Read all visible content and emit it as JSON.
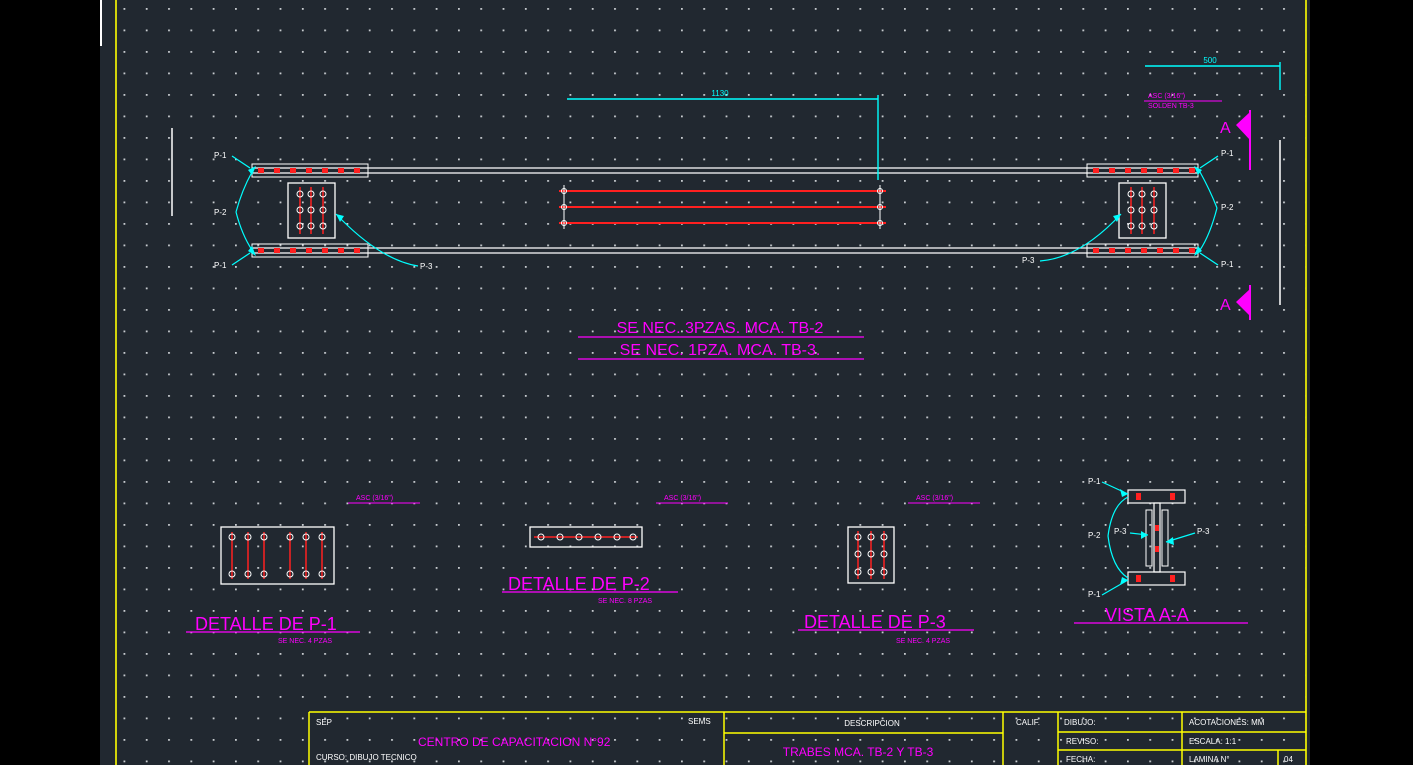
{
  "colors": {
    "background": "#000000",
    "sheet": "#212830",
    "grid_dot": "#c8ccd0",
    "frame": "#ffff00",
    "dimension": "#00ffff",
    "steel": "#ffffff",
    "rebar": "#ff2020",
    "annotation": "#ff00ff"
  },
  "elevation": {
    "dim_main": "1130",
    "dim_side": "500",
    "side_note_line1": "ASC (3/16\")",
    "side_note_line2": "SOLDEN TB-3",
    "section_mark_top": "A",
    "section_mark_bottom": "A",
    "labels": {
      "left_top_p1": "P-1",
      "left_mid_p2": "P-2",
      "left_bottom_p1": "P-1",
      "left_p3": "P-3",
      "right_top_p1": "P-1",
      "right_mid_p2": "P-2",
      "right_bottom_p1": "P-1",
      "right_p3": "P-3"
    },
    "note_line1": "SE NEC. 3PZAS. MCA. TB-2",
    "note_line2": "SE NEC. 1PZA. MCA. TB-3."
  },
  "details": {
    "p1": {
      "weld": "ASC (3/16\")",
      "title": "DETALLE DE P-1",
      "qty": "SE NEC. 4 PZAS"
    },
    "p2": {
      "weld": "ASC (3/16\")",
      "title": "DETALLE DE P-2",
      "qty": "SE NEC. 8 PZAS"
    },
    "p3": {
      "weld": "ASC (3/16\")",
      "title": "DETALLE DE P-3",
      "qty": "SE NEC. 4 PZAS"
    },
    "section": {
      "title": "VISTA A-A",
      "labels": {
        "top_p1": "P-1",
        "mid_p2": "P-2",
        "left_p3": "P-3",
        "right_p3": "P-3",
        "bottom_p1": "P-1"
      }
    }
  },
  "title_block": {
    "sep": "SEP",
    "semis": "SEMS",
    "center": "CENTRO DE CAPACITACION N°92",
    "course": "CURSO: DIBUJO TECNICO",
    "descripcion_header": "DESCRIPCION",
    "descripcion": "TRABES MCA. TB-2 Y TB-3",
    "calif": "CALIF.",
    "dibujo": "DIBUJO:",
    "reviso": "REVISO:",
    "fecha": "FECHA:",
    "acotaciones": "ACOTACIONES:  MM",
    "escala": "ESCALA:  1:1",
    "lamina": "LAMINA N°",
    "lamina_num": "04"
  }
}
